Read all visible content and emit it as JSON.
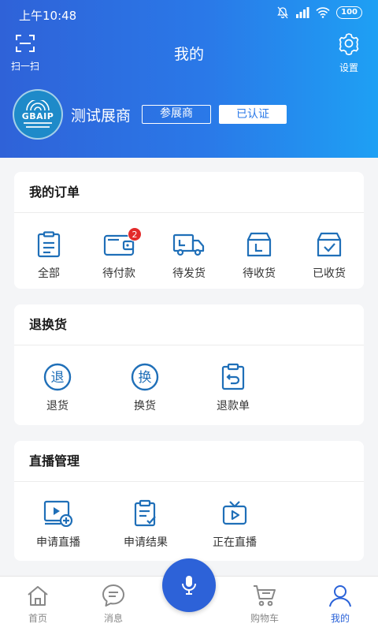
{
  "status_bar": {
    "time": "上午10:48",
    "battery": "100"
  },
  "header": {
    "scan_label": "扫一扫",
    "title": "我的",
    "settings_label": "设置"
  },
  "profile": {
    "logo_text": "GBAIP",
    "name": "测试展商",
    "role_tag": "参展商",
    "verified_tag": "已认证"
  },
  "orders": {
    "title": "我的订单",
    "items": [
      {
        "label": "全部",
        "icon": "clipboard-icon"
      },
      {
        "label": "待付款",
        "icon": "wallet-icon",
        "badge": "2"
      },
      {
        "label": "待发货",
        "icon": "truck-icon"
      },
      {
        "label": "待收货",
        "icon": "box-icon"
      },
      {
        "label": "已收货",
        "icon": "box-check-icon"
      }
    ]
  },
  "returns": {
    "title": "退换货",
    "items": [
      {
        "label": "退货",
        "glyph": "退",
        "icon": "return-icon"
      },
      {
        "label": "换货",
        "glyph": "换",
        "icon": "exchange-icon"
      },
      {
        "label": "退款单",
        "icon": "refund-clipboard-icon"
      }
    ]
  },
  "live": {
    "title": "直播管理",
    "items": [
      {
        "label": "申请直播",
        "icon": "apply-live-icon"
      },
      {
        "label": "申请结果",
        "icon": "result-list-icon"
      },
      {
        "label": "正在直播",
        "icon": "tv-play-icon"
      }
    ]
  },
  "tabbar": {
    "items": [
      {
        "label": "首页",
        "icon": "home-icon"
      },
      {
        "label": "消息",
        "icon": "message-icon"
      },
      {
        "label": "购物车",
        "icon": "cart-icon"
      },
      {
        "label": "我的",
        "icon": "user-icon",
        "active": true
      }
    ]
  },
  "colors": {
    "primary": "#2a62d8",
    "badge": "#e32a2a",
    "icon": "#1f6fb8"
  }
}
